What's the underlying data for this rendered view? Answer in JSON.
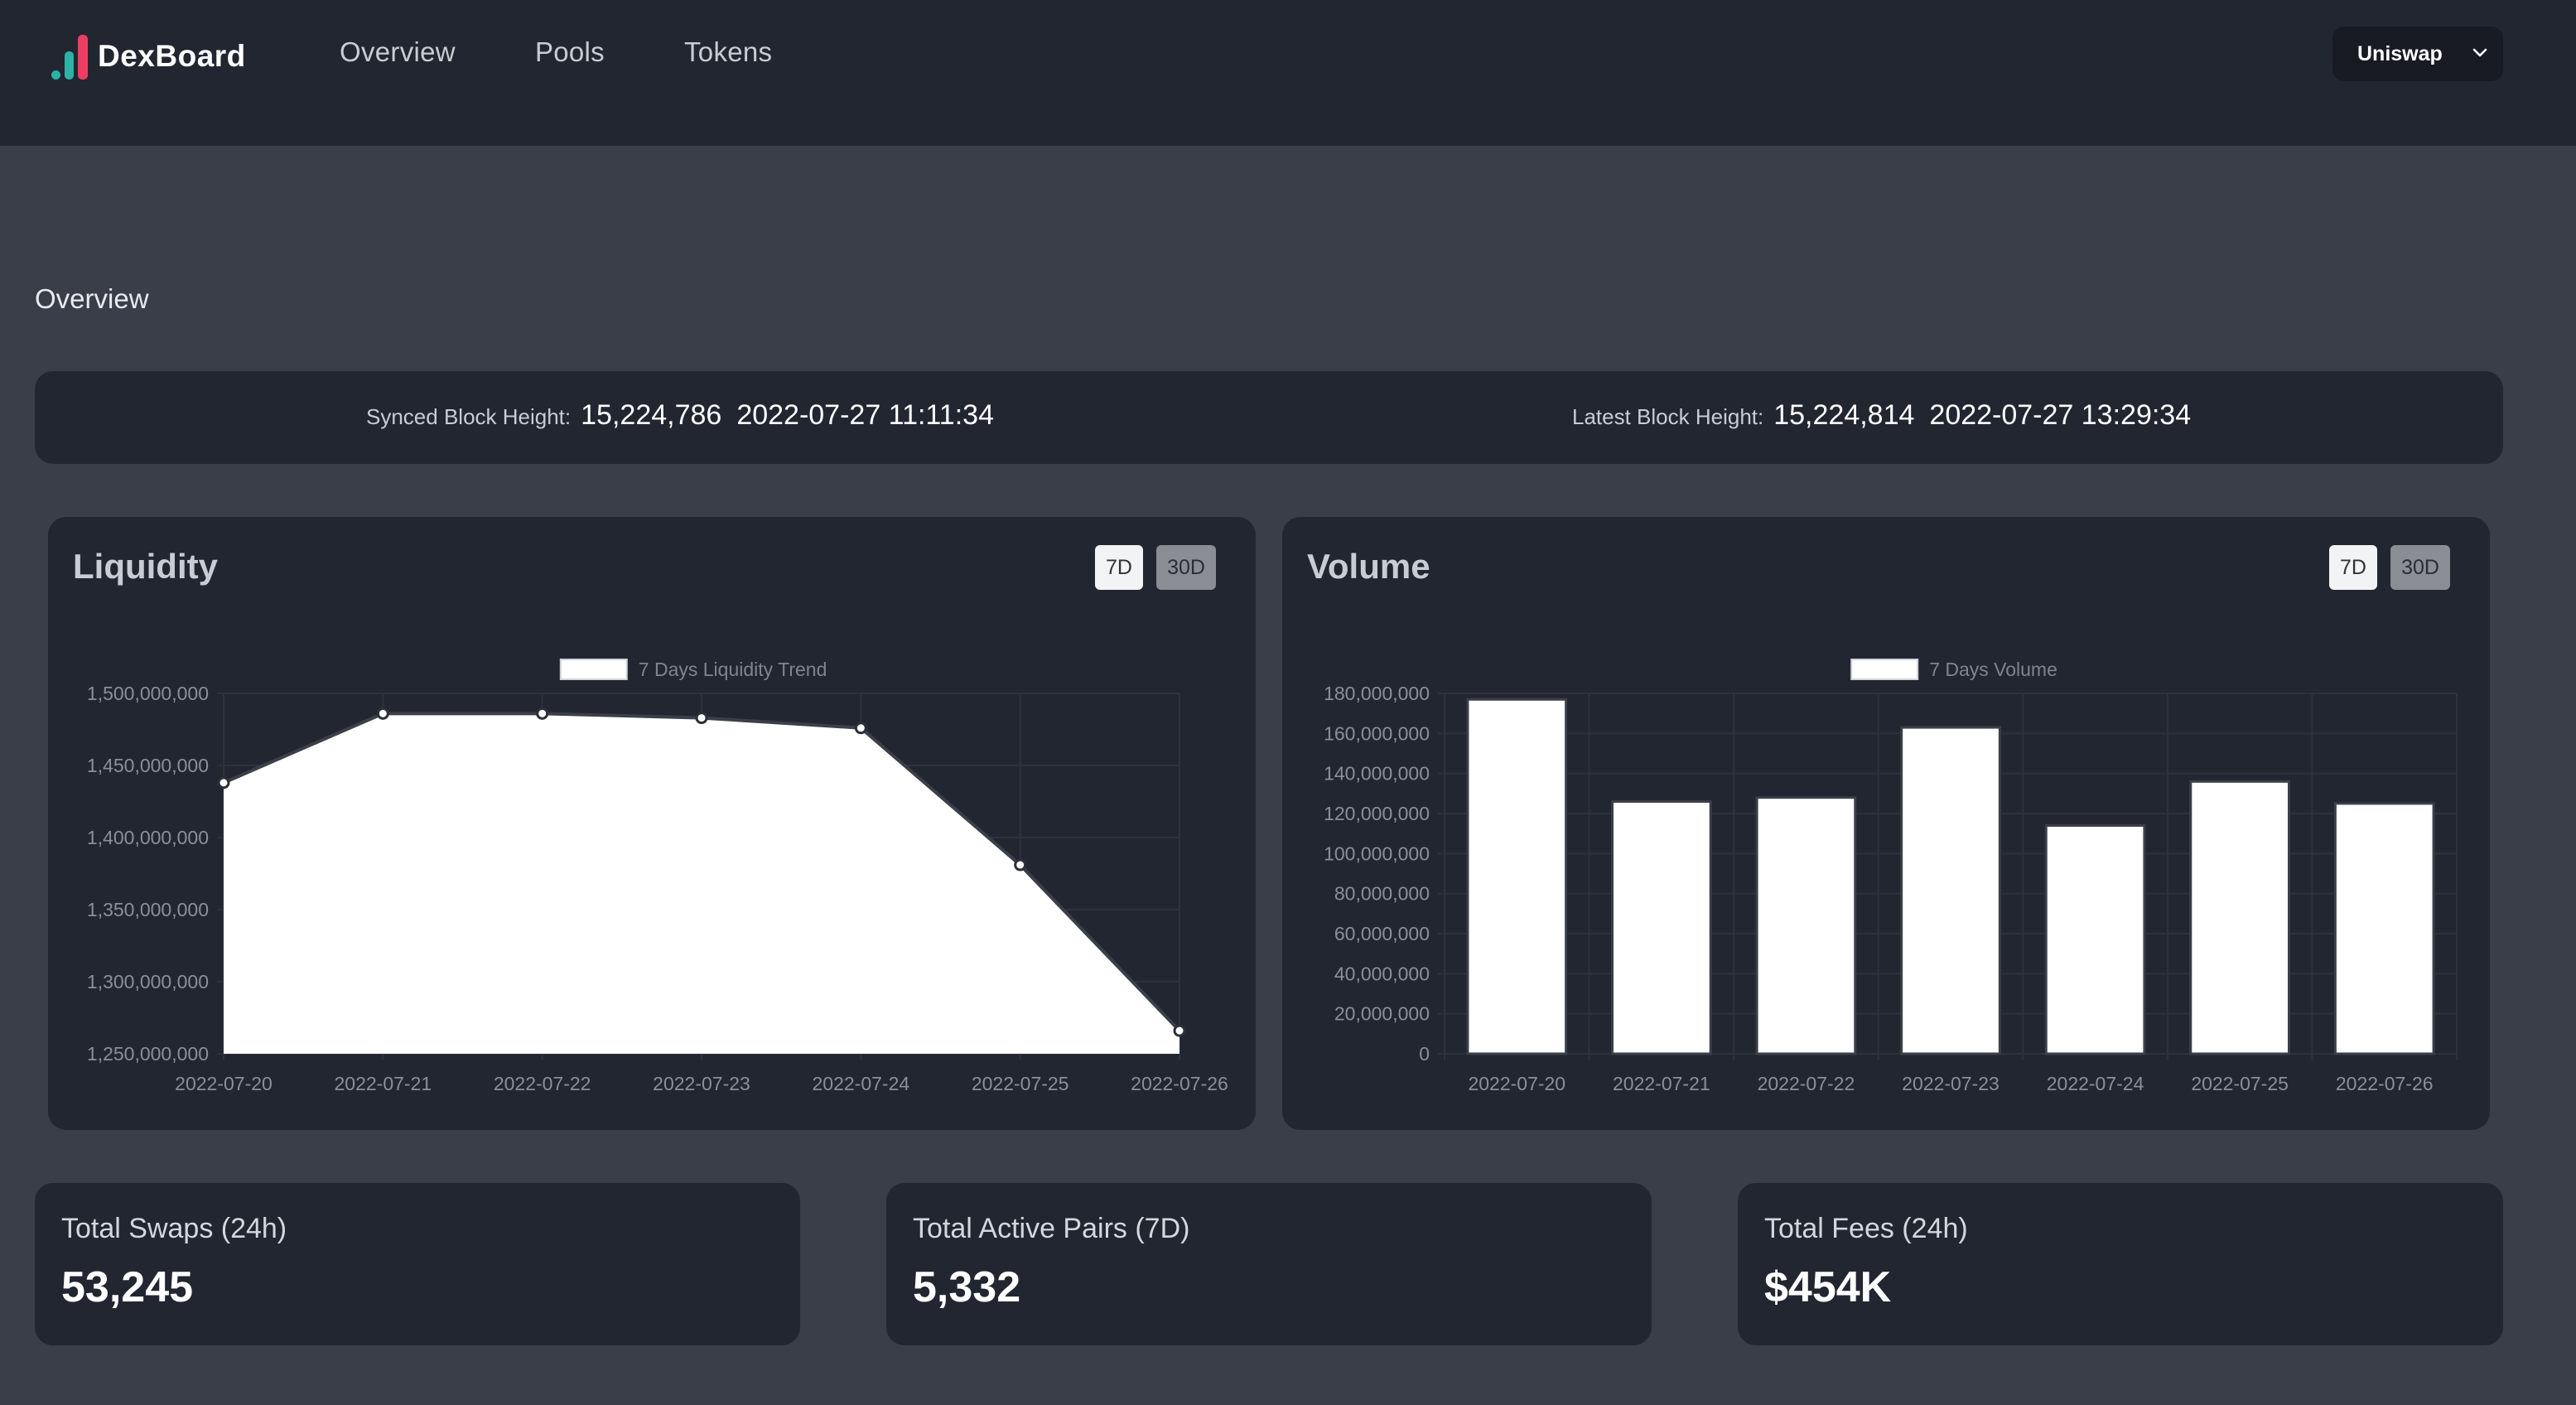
{
  "app": {
    "name": "DexBoard"
  },
  "nav": {
    "items": [
      "Overview",
      "Pools",
      "Tokens"
    ]
  },
  "exchange_select": {
    "value": "Uniswap"
  },
  "section": {
    "title": "Overview"
  },
  "blocks": {
    "synced": {
      "label": "Synced Block Height:",
      "number": "15,224,786",
      "time": "2022-07-27 11:11:34"
    },
    "latest": {
      "label": "Latest Block Height:",
      "number": "15,224,814",
      "time": "2022-07-27 13:29:34"
    }
  },
  "liquidity_card": {
    "title": "Liquidity",
    "range_7d": "7D",
    "range_30d": "30D"
  },
  "volume_card": {
    "title": "Volume",
    "range_7d": "7D",
    "range_30d": "30D"
  },
  "stats": [
    {
      "label": "Total Swaps (24h)",
      "value": "53,245"
    },
    {
      "label": "Total Active Pairs (7D)",
      "value": "5,332"
    },
    {
      "label": "Total Fees (24h)",
      "value": "$454K"
    }
  ],
  "colors": {
    "page_bg": "#3a3e48",
    "panel_bg": "#222631",
    "accent_teal": "#2bb3a7",
    "accent_pink": "#ec3d63",
    "series_fill": "#ffffff"
  },
  "chart_data": [
    {
      "type": "area",
      "series": [
        {
          "name": "7 Days Liquidity Trend",
          "values": [
            1438000000,
            1486000000,
            1486000000,
            1483000000,
            1476000000,
            1381000000,
            1266000000
          ]
        }
      ],
      "categories": [
        "2022-07-20",
        "2022-07-21",
        "2022-07-22",
        "2022-07-23",
        "2022-07-24",
        "2022-07-25",
        "2022-07-26"
      ],
      "ylim": [
        1250000000,
        1500000000
      ],
      "yticks": [
        "1,500,000,000",
        "1,450,000,000",
        "1,400,000,000",
        "1,350,000,000",
        "1,300,000,000",
        "1,250,000,000"
      ],
      "legend": "top-center",
      "grid": true
    },
    {
      "type": "bar",
      "series": [
        {
          "name": "7 Days Volume",
          "values": [
            177000000,
            126000000,
            128000000,
            163000000,
            114000000,
            136000000,
            125000000
          ]
        }
      ],
      "categories": [
        "2022-07-20",
        "2022-07-21",
        "2022-07-22",
        "2022-07-23",
        "2022-07-24",
        "2022-07-25",
        "2022-07-26"
      ],
      "ylim": [
        0,
        180000000
      ],
      "yticks": [
        "180,000,000",
        "160,000,000",
        "140,000,000",
        "120,000,000",
        "100,000,000",
        "80,000,000",
        "60,000,000",
        "40,000,000",
        "20,000,000",
        "0"
      ],
      "legend": "top-center",
      "grid": true
    }
  ]
}
